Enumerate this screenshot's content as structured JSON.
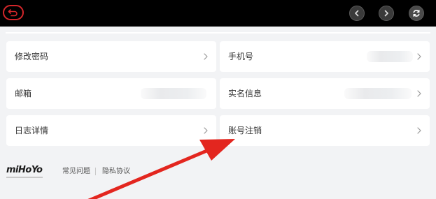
{
  "topbar": {
    "back_icon": "back-arrow-icon",
    "prev_icon": "chevron-left-icon",
    "next_icon": "chevron-right-icon",
    "refresh_icon": "refresh-icon",
    "accent": "#d4262a"
  },
  "settings": {
    "change_password": "修改密码",
    "phone": "手机号",
    "email": "邮箱",
    "real_name": "实名信息",
    "log_details": "日志详情",
    "delete_account": "账号注销"
  },
  "footer": {
    "logo": "miHoYo",
    "faq": "常见问题",
    "privacy": "隐私协议"
  }
}
